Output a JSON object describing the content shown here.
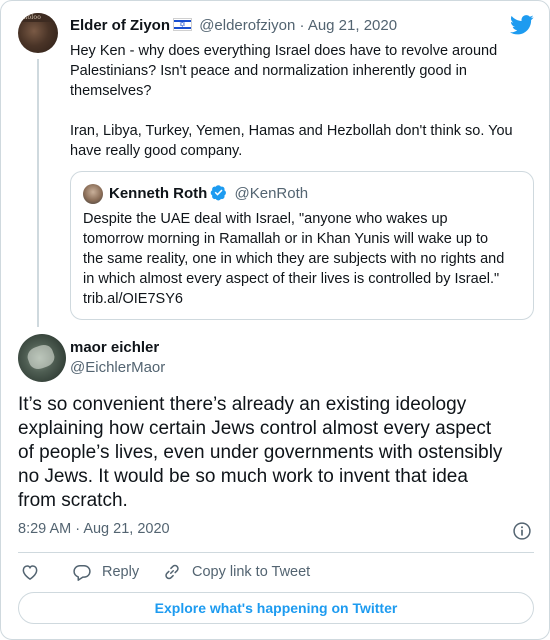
{
  "parent_tweet": {
    "author_name": "Elder of Ziyon",
    "handle": "@elderofziyon",
    "separator": "·",
    "date": "Aug 21, 2020",
    "avatar_text": "Zioloo",
    "paragraphs": [
      "Hey Ken - why does everything Israel does have to revolve around Palestinians? Isn't peace and normalization inherently good in themselves?",
      "Iran, Libya, Turkey, Yemen, Hamas and Hezbollah don't think so. You have really good company."
    ]
  },
  "quoted_tweet": {
    "author_name": "Kenneth Roth",
    "handle": "@KenRoth",
    "lines": [
      "Despite the UAE deal with Israel, \"anyone who wakes up",
      "tomorrow morning in Ramallah or in Khan Yunis will wake up to",
      "the same reality, one in which they are subjects with no rights and",
      "in which almost every aspect of their lives is controlled by Israel.\"",
      "trib.al/OIE7SY6"
    ]
  },
  "main_tweet": {
    "author_name": "maor eichler",
    "handle": "@EichlerMaor",
    "lines": [
      "It’s so convenient there’s already an existing ideology",
      "explaining how certain Jews control almost every aspect",
      "of people’s lives, even under governments with ostensibly",
      "no Jews. It would be so much work to invent that idea",
      "from scratch."
    ],
    "time": "8:29 AM",
    "separator": "·",
    "date": "Aug 21, 2020"
  },
  "actions": {
    "reply_label": "Reply",
    "copy_link_label": "Copy link to Tweet"
  },
  "explore_label": "Explore what's happening on Twitter",
  "colors": {
    "twitter_blue": "#1d9bf0",
    "text": "#0f1419",
    "muted": "#536471",
    "border": "#cfd9de",
    "flag_blue": "#1a4fd0"
  },
  "icons": [
    "twitter-bird-icon",
    "israel-flag-icon",
    "verified-badge-icon",
    "info-icon",
    "heart-icon",
    "reply-bubble-icon",
    "link-icon"
  ]
}
